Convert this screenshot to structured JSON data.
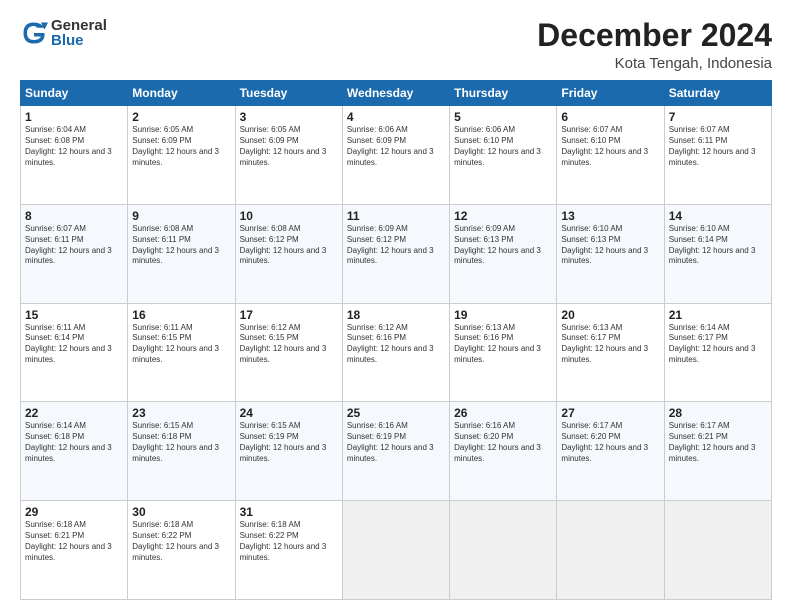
{
  "logo": {
    "general": "General",
    "blue": "Blue"
  },
  "title": "December 2024",
  "location": "Kota Tengah, Indonesia",
  "headers": [
    "Sunday",
    "Monday",
    "Tuesday",
    "Wednesday",
    "Thursday",
    "Friday",
    "Saturday"
  ],
  "weeks": [
    [
      {
        "day": "1",
        "sunrise": "6:04 AM",
        "sunset": "6:08 PM",
        "daylight": "12 hours and 3 minutes."
      },
      {
        "day": "2",
        "sunrise": "6:05 AM",
        "sunset": "6:09 PM",
        "daylight": "12 hours and 3 minutes."
      },
      {
        "day": "3",
        "sunrise": "6:05 AM",
        "sunset": "6:09 PM",
        "daylight": "12 hours and 3 minutes."
      },
      {
        "day": "4",
        "sunrise": "6:06 AM",
        "sunset": "6:09 PM",
        "daylight": "12 hours and 3 minutes."
      },
      {
        "day": "5",
        "sunrise": "6:06 AM",
        "sunset": "6:10 PM",
        "daylight": "12 hours and 3 minutes."
      },
      {
        "day": "6",
        "sunrise": "6:07 AM",
        "sunset": "6:10 PM",
        "daylight": "12 hours and 3 minutes."
      },
      {
        "day": "7",
        "sunrise": "6:07 AM",
        "sunset": "6:11 PM",
        "daylight": "12 hours and 3 minutes."
      }
    ],
    [
      {
        "day": "8",
        "sunrise": "6:07 AM",
        "sunset": "6:11 PM",
        "daylight": "12 hours and 3 minutes."
      },
      {
        "day": "9",
        "sunrise": "6:08 AM",
        "sunset": "6:11 PM",
        "daylight": "12 hours and 3 minutes."
      },
      {
        "day": "10",
        "sunrise": "6:08 AM",
        "sunset": "6:12 PM",
        "daylight": "12 hours and 3 minutes."
      },
      {
        "day": "11",
        "sunrise": "6:09 AM",
        "sunset": "6:12 PM",
        "daylight": "12 hours and 3 minutes."
      },
      {
        "day": "12",
        "sunrise": "6:09 AM",
        "sunset": "6:13 PM",
        "daylight": "12 hours and 3 minutes."
      },
      {
        "day": "13",
        "sunrise": "6:10 AM",
        "sunset": "6:13 PM",
        "daylight": "12 hours and 3 minutes."
      },
      {
        "day": "14",
        "sunrise": "6:10 AM",
        "sunset": "6:14 PM",
        "daylight": "12 hours and 3 minutes."
      }
    ],
    [
      {
        "day": "15",
        "sunrise": "6:11 AM",
        "sunset": "6:14 PM",
        "daylight": "12 hours and 3 minutes."
      },
      {
        "day": "16",
        "sunrise": "6:11 AM",
        "sunset": "6:15 PM",
        "daylight": "12 hours and 3 minutes."
      },
      {
        "day": "17",
        "sunrise": "6:12 AM",
        "sunset": "6:15 PM",
        "daylight": "12 hours and 3 minutes."
      },
      {
        "day": "18",
        "sunrise": "6:12 AM",
        "sunset": "6:16 PM",
        "daylight": "12 hours and 3 minutes."
      },
      {
        "day": "19",
        "sunrise": "6:13 AM",
        "sunset": "6:16 PM",
        "daylight": "12 hours and 3 minutes."
      },
      {
        "day": "20",
        "sunrise": "6:13 AM",
        "sunset": "6:17 PM",
        "daylight": "12 hours and 3 minutes."
      },
      {
        "day": "21",
        "sunrise": "6:14 AM",
        "sunset": "6:17 PM",
        "daylight": "12 hours and 3 minutes."
      }
    ],
    [
      {
        "day": "22",
        "sunrise": "6:14 AM",
        "sunset": "6:18 PM",
        "daylight": "12 hours and 3 minutes."
      },
      {
        "day": "23",
        "sunrise": "6:15 AM",
        "sunset": "6:18 PM",
        "daylight": "12 hours and 3 minutes."
      },
      {
        "day": "24",
        "sunrise": "6:15 AM",
        "sunset": "6:19 PM",
        "daylight": "12 hours and 3 minutes."
      },
      {
        "day": "25",
        "sunrise": "6:16 AM",
        "sunset": "6:19 PM",
        "daylight": "12 hours and 3 minutes."
      },
      {
        "day": "26",
        "sunrise": "6:16 AM",
        "sunset": "6:20 PM",
        "daylight": "12 hours and 3 minutes."
      },
      {
        "day": "27",
        "sunrise": "6:17 AM",
        "sunset": "6:20 PM",
        "daylight": "12 hours and 3 minutes."
      },
      {
        "day": "28",
        "sunrise": "6:17 AM",
        "sunset": "6:21 PM",
        "daylight": "12 hours and 3 minutes."
      }
    ],
    [
      {
        "day": "29",
        "sunrise": "6:18 AM",
        "sunset": "6:21 PM",
        "daylight": "12 hours and 3 minutes."
      },
      {
        "day": "30",
        "sunrise": "6:18 AM",
        "sunset": "6:22 PM",
        "daylight": "12 hours and 3 minutes."
      },
      {
        "day": "31",
        "sunrise": "6:18 AM",
        "sunset": "6:22 PM",
        "daylight": "12 hours and 3 minutes."
      },
      null,
      null,
      null,
      null
    ]
  ]
}
